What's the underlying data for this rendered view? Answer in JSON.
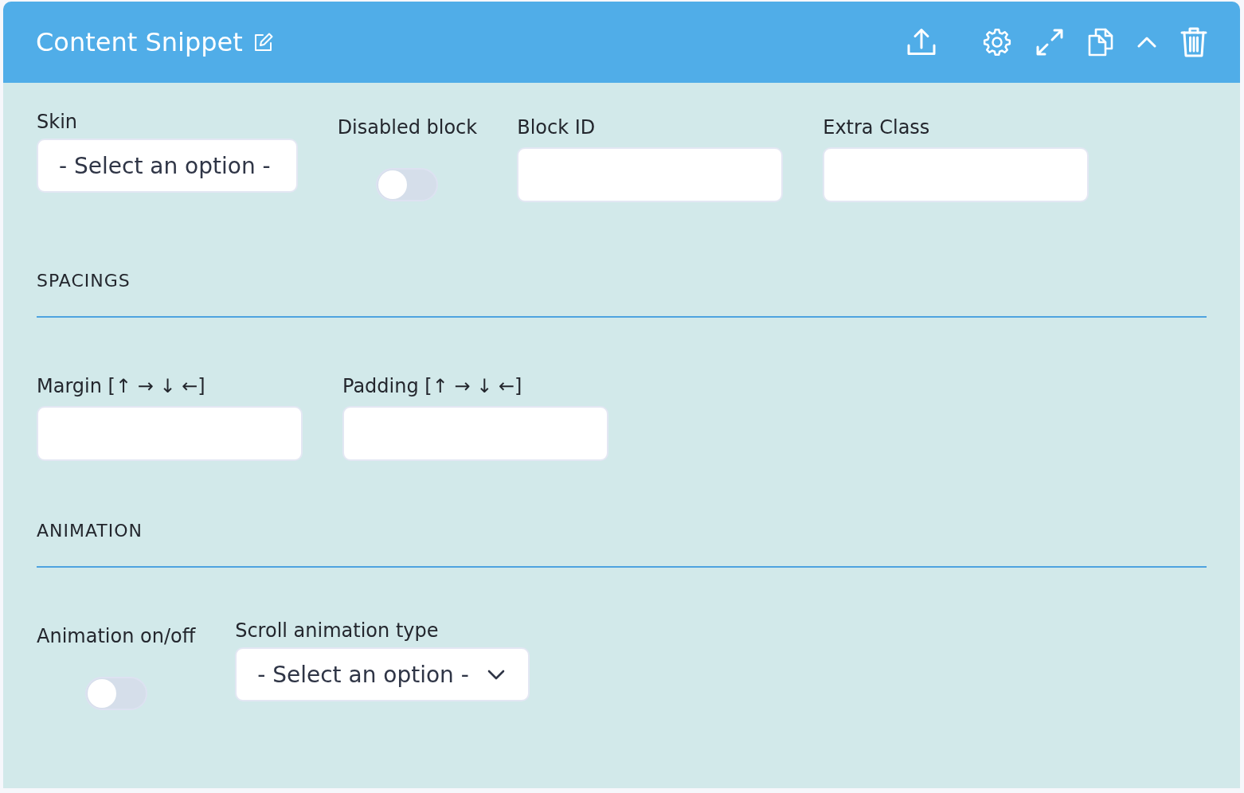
{
  "header": {
    "title": "Content Snippet"
  },
  "general_fields": [
    {
      "kind": "select",
      "label": "Skin",
      "value": "- Select an option -",
      "caret": false
    },
    {
      "kind": "toggle",
      "label": "Disabled block",
      "on": false
    },
    {
      "kind": "text",
      "label": "Block ID"
    },
    {
      "kind": "text",
      "label": "Extra Class"
    }
  ],
  "sections": [
    {
      "heading": "SPACINGS",
      "fields": [
        {
          "kind": "text",
          "label": "Margin [↑ → ↓ ←]"
        },
        {
          "kind": "text",
          "label": "Padding [↑ → ↓ ←]"
        }
      ]
    },
    {
      "heading": "ANIMATION",
      "fields": [
        {
          "kind": "toggle",
          "label": "Animation on/off",
          "on": false
        },
        {
          "kind": "select",
          "label": "Scroll animation type",
          "value": "- Select an option -",
          "caret": true
        }
      ]
    }
  ]
}
